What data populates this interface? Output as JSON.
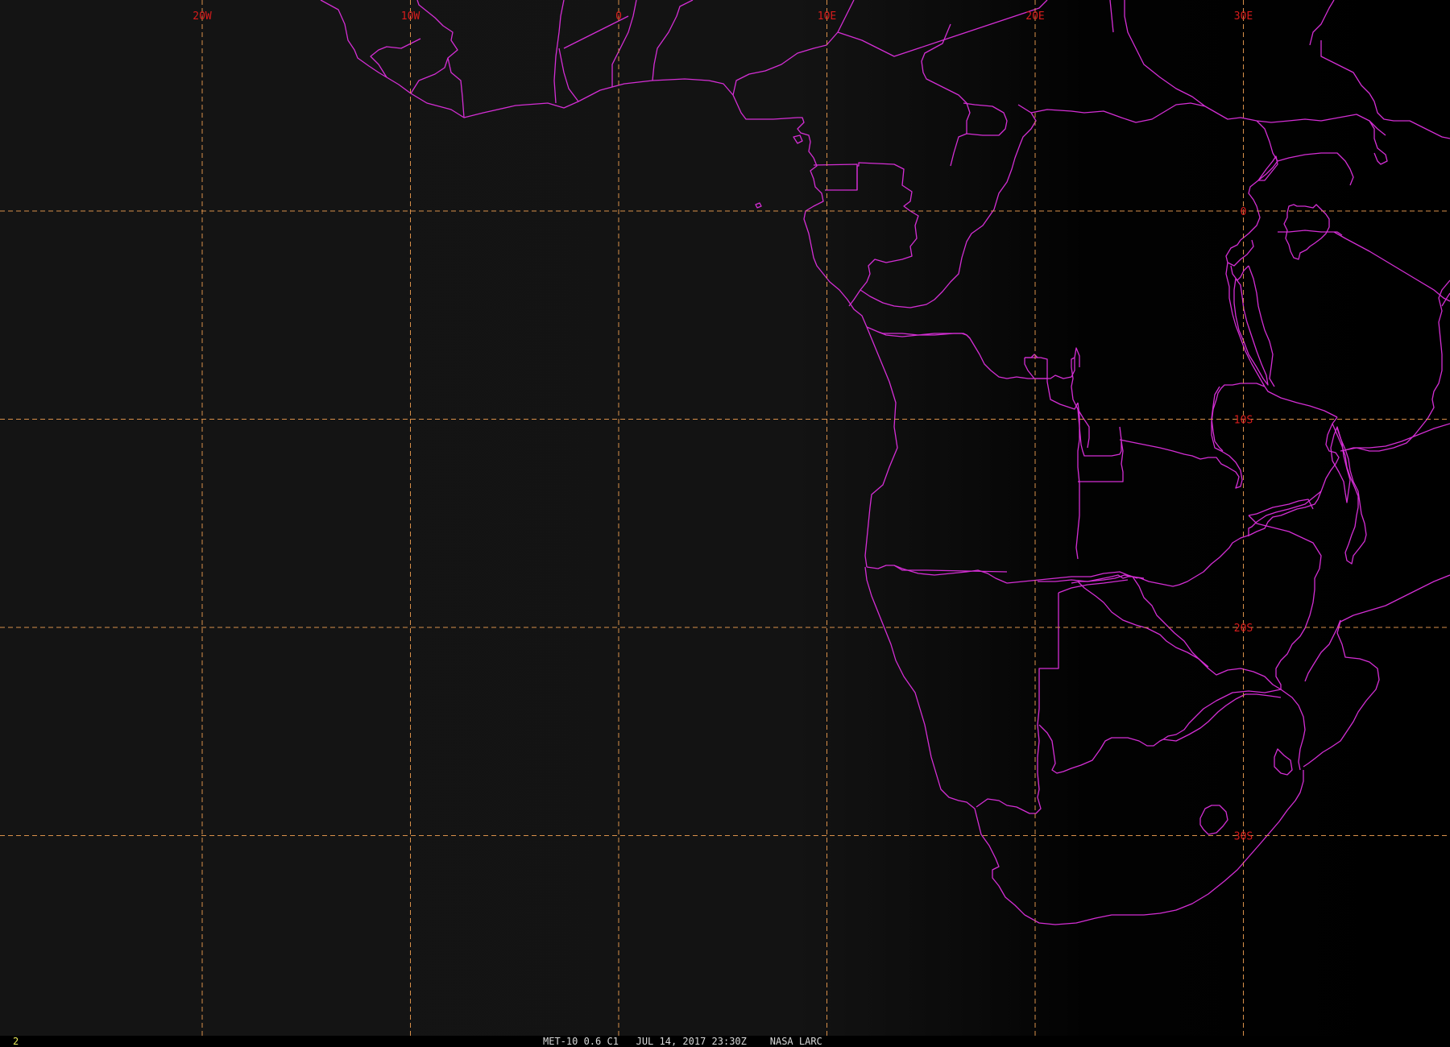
{
  "colors": {
    "grid": "#d9904a",
    "label": "#d81c1c",
    "border": "#d42ed4",
    "frame_num": "#e8e85a",
    "status_text": "#d8d8d8"
  },
  "grid": {
    "longitudes": [
      {
        "deg": -20,
        "label": "20W"
      },
      {
        "deg": -10,
        "label": "10W"
      },
      {
        "deg": 0,
        "label": "0"
      },
      {
        "deg": 10,
        "label": "10E"
      },
      {
        "deg": 20,
        "label": "20E"
      },
      {
        "deg": 30,
        "label": "30E"
      }
    ],
    "latitudes": [
      {
        "deg": 0,
        "label": "0"
      },
      {
        "deg": -10,
        "label": "10S"
      },
      {
        "deg": -20,
        "label": "20S"
      },
      {
        "deg": -30,
        "label": "30S"
      }
    ]
  },
  "status_bar": {
    "frame_number": "2",
    "caption": "MET-10 0.6 C1   JUL 14, 2017 23:30Z    NASA LARC"
  }
}
